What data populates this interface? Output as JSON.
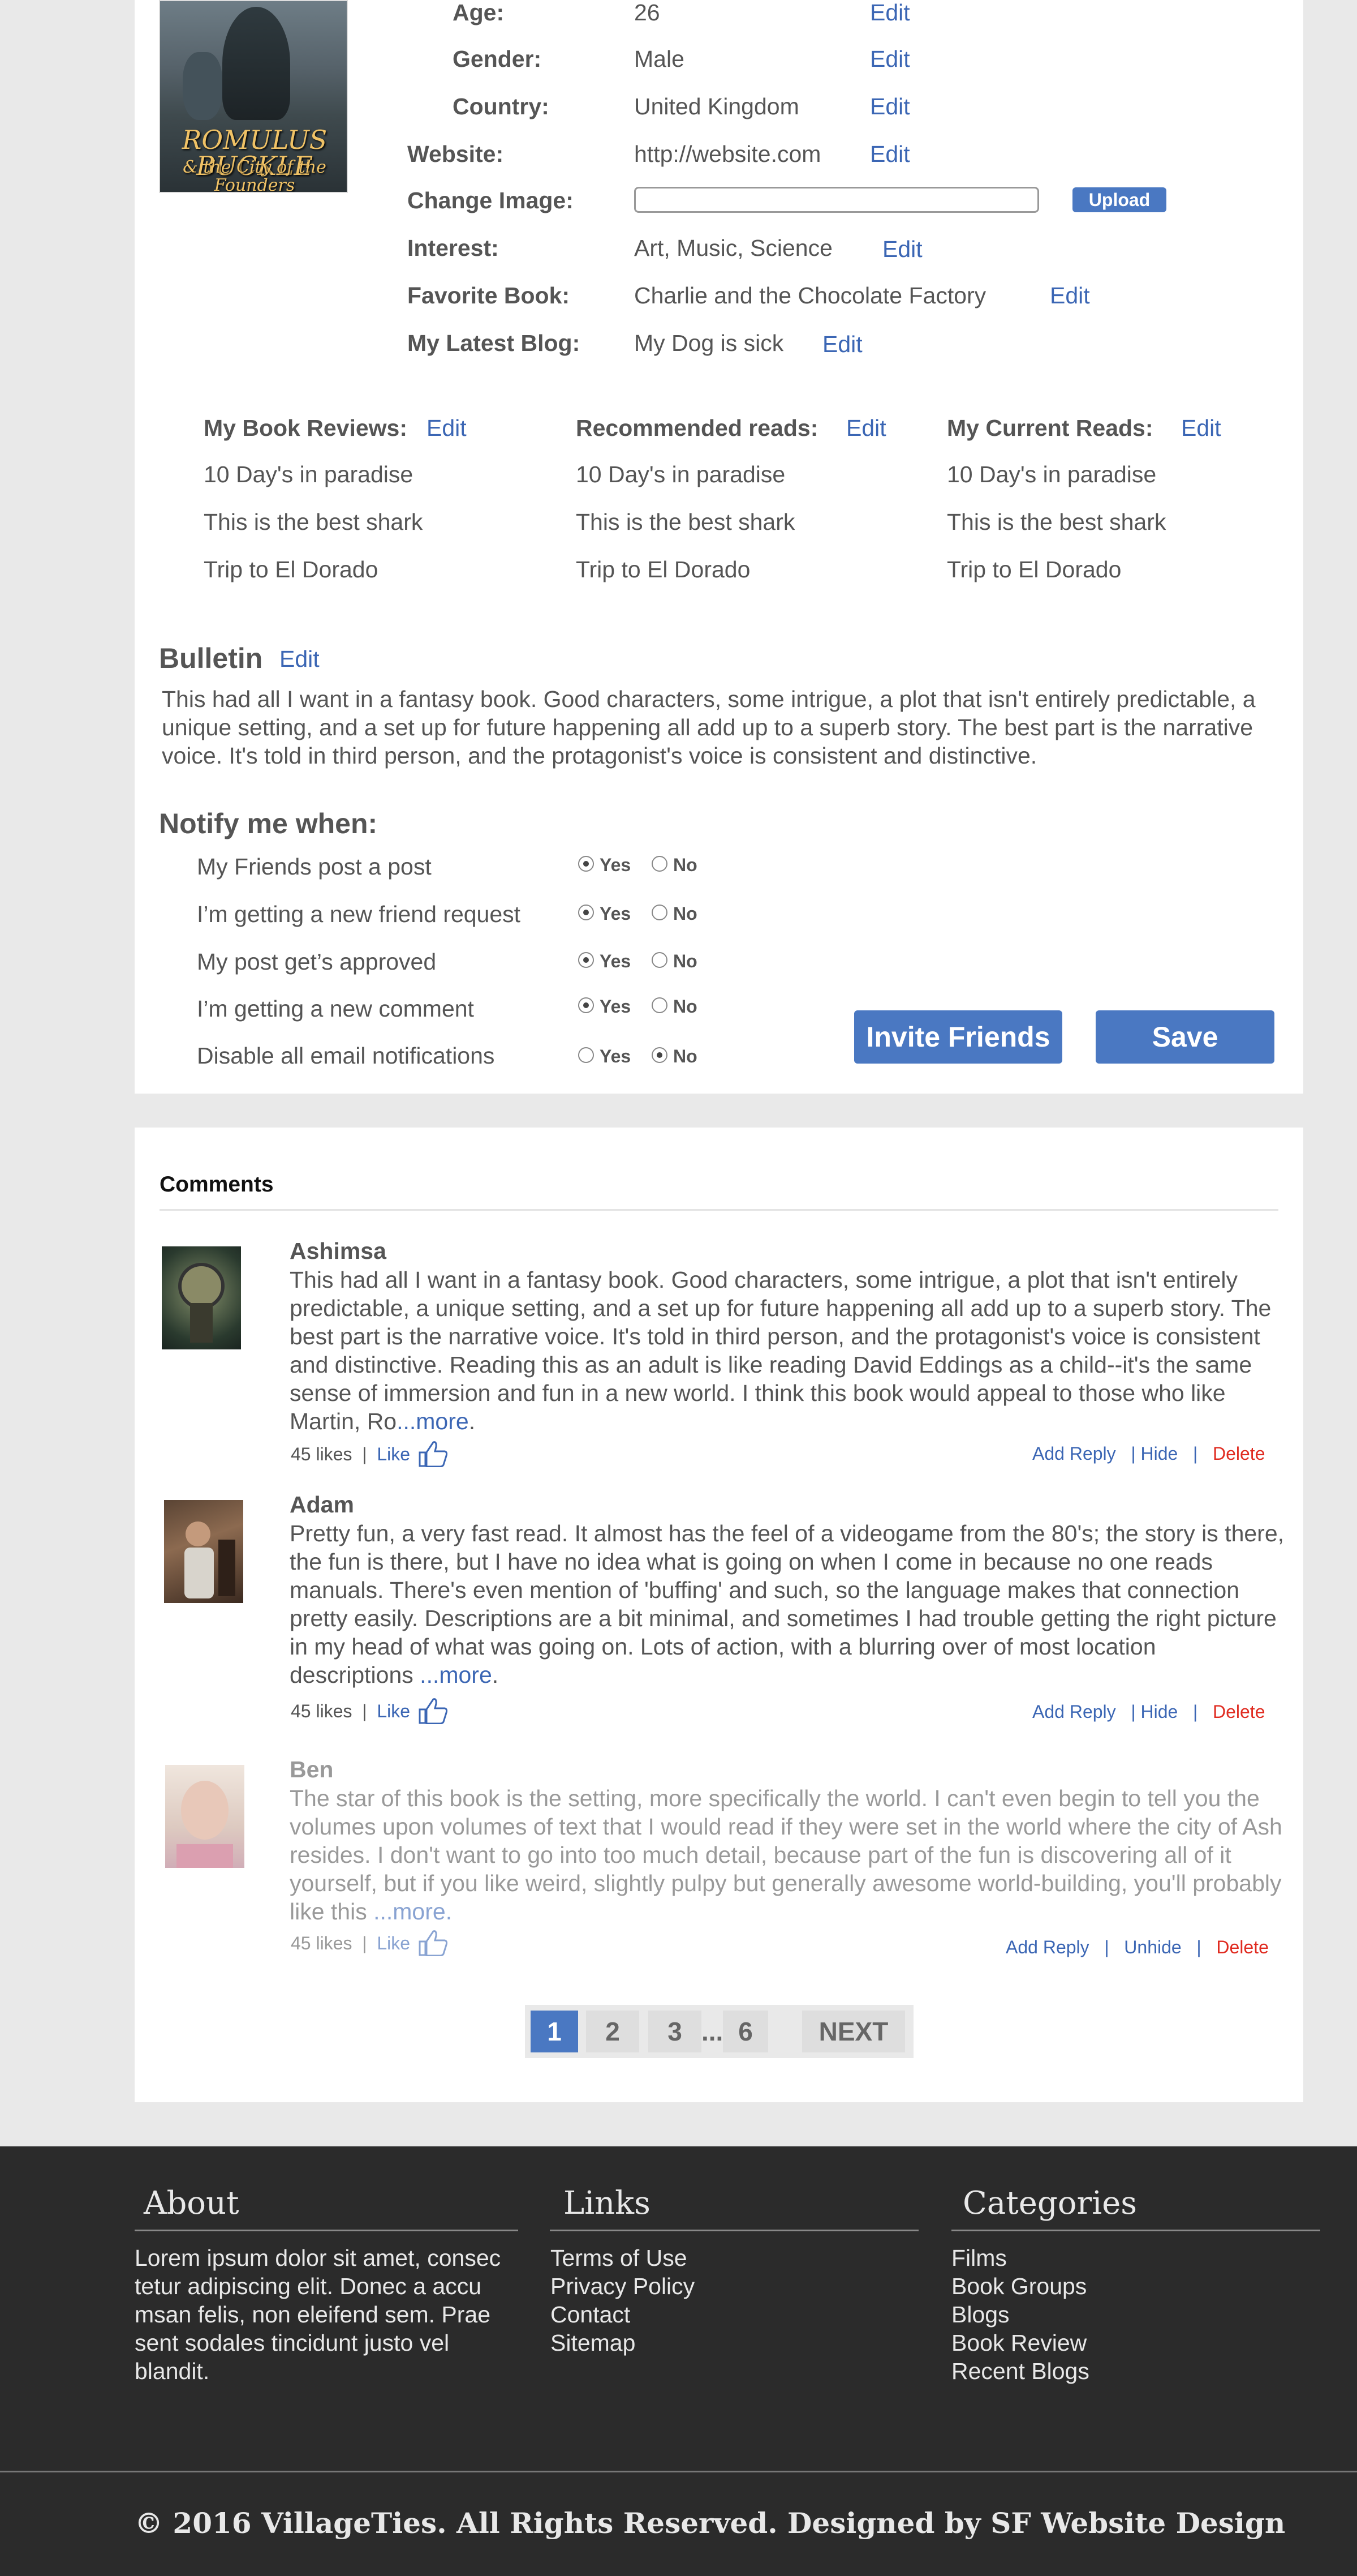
{
  "profile": {
    "cover": {
      "title": "ROMULUS BUCKLE",
      "subtitle": "& the City of the Founders"
    },
    "fields": {
      "age": {
        "label": "Age:",
        "value": "26"
      },
      "gender": {
        "label": "Gender:",
        "value": "Male"
      },
      "country": {
        "label": "Country:",
        "value": "United Kingdom"
      },
      "website": {
        "label": "Website:",
        "value": "http://website.com"
      },
      "change_image": {
        "label": "Change Image:"
      },
      "interest": {
        "label": "Interest:",
        "value": "Art, Music, Science"
      },
      "favorite_book": {
        "label": "Favorite Book:",
        "value": "Charlie and the Chocolate Factory"
      },
      "latest_blog": {
        "label": "My Latest Blog:",
        "value": "My Dog is sick"
      }
    },
    "edit_label": "Edit",
    "upload_label": "Upload"
  },
  "lists": {
    "book_reviews": {
      "title": "My Book Reviews:",
      "items": [
        "10 Day's in paradise",
        "This is the best shark",
        "Trip to El Dorado"
      ]
    },
    "recommended": {
      "title": "Recommended reads:",
      "items": [
        "10 Day's in paradise",
        "This is the best shark",
        "Trip to El Dorado"
      ]
    },
    "current": {
      "title": "My Current Reads:",
      "items": [
        "10 Day's in paradise",
        "This is the best shark",
        "Trip to El Dorado"
      ]
    }
  },
  "bulletin": {
    "title": "Bulletin",
    "text": "This had all I want in a fantasy book. Good characters, some intrigue, a plot that isn't entirely predictable, a unique setting, and a set up for future happening all add up to a superb story. The best part is the narrative voice. It's told in third person, and the protagonist's voice is consistent and distinctive."
  },
  "notify": {
    "title": "Notify me when:",
    "yes_label": "Yes",
    "no_label": "No",
    "rows": [
      {
        "label": "My Friends post a post",
        "selected": "yes"
      },
      {
        "label": "I’m getting a new friend request",
        "selected": "yes"
      },
      {
        "label": "My post get’s approved",
        "selected": "yes"
      },
      {
        "label": "I’m getting a new comment",
        "selected": "yes"
      },
      {
        "label": "Disable all email notifications",
        "selected": "no"
      }
    ],
    "invite_label": "Invite Friends",
    "save_label": "Save"
  },
  "comments": {
    "title": "Comments",
    "likes_label": "45 likes",
    "like_label": "Like",
    "add_reply_label": "Add Reply",
    "hide_label": "Hide",
    "unhide_label": "Unhide",
    "delete_label": "Delete",
    "more_label": "...more",
    "items": [
      {
        "name": "Ashimsa",
        "text": "This had all I want in a fantasy book. Good characters, some intrigue, a plot that isn't entirely predictable, a unique setting, and a set up for future happening all add up to a superb story. The best part is the narrative voice. It's told in third person, and the protagonist's voice is consistent and distinctive. Reading this as an adult is like reading David Eddings as a child--it's the same sense of immersion and fun in a new world. I think this book would appeal to those who like Martin, Ro",
        "more": "...more",
        "trail": ".",
        "hidden": false
      },
      {
        "name": "Adam",
        "text": "Pretty fun, a very fast read. It almost has the feel of a videogame from the 80's; the story is there, the fun is there, but I have no idea what is going on when I come in because no one reads manuals. There's even mention of 'buffing' and such, so the language makes that connection pretty easily. Descriptions are a bit minimal, and sometimes I had trouble getting the right picture in my head of what was going on. Lots of action, with a blurring over of most location descriptions ",
        "more": "...more",
        "trail": ".",
        "hidden": false
      },
      {
        "name": "Ben",
        "text": "The star of this book is the setting, more specifically the world. I can't even begin to tell you the volumes upon volumes of text that I would read if they were set in the world where the city of Ash resides. I don't want to go into too much detail, because part of the fun is discovering all of it yourself, but if you like weird, slightly pulpy but generally awesome world-building, you'll probably like this ",
        "more": "...more.",
        "trail": "",
        "hidden": true
      }
    ]
  },
  "pagination": {
    "pages": [
      "1",
      "2",
      "3",
      "...",
      "6"
    ],
    "next_label": "NEXT",
    "current": 1
  },
  "footer": {
    "about": {
      "title": "About",
      "text": "Lorem ipsum dolor sit amet, consec tetur adipiscing elit. Donec a accu msan felis, non eleifend sem. Prae sent sodales tincidunt justo vel blandit."
    },
    "links": {
      "title": "Links",
      "items": [
        "Terms of Use",
        "Privacy Policy",
        "Contact",
        "Sitemap"
      ]
    },
    "categories": {
      "title": "Categories",
      "items": [
        "Films",
        "Book Groups",
        "Blogs",
        "Book Review",
        "Recent Blogs"
      ]
    },
    "copyright": "© 2016 VillageTies. All Rights Reserved. Designed by SF Website Design"
  },
  "colors": {
    "accent": "#4a78c2",
    "link": "#3b66b4",
    "delete": "#e02b20",
    "footer_bg": "#2b2b2b",
    "page_bg": "#e9e9e9"
  }
}
